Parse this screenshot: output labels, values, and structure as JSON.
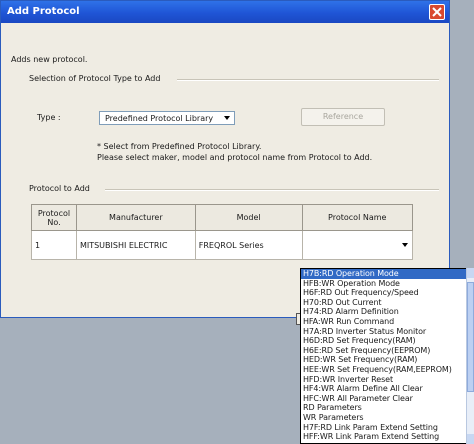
{
  "dialog": {
    "title": "Add Protocol",
    "intro": "Adds new protocol.",
    "type_section_label": "Selection of Protocol Type to Add",
    "type_label": "Type :",
    "type_value": "Predefined Protocol Library",
    "reference_button": "Reference",
    "note_line1": "* Select from Predefined Protocol Library.",
    "note_line2": "Please select maker, model and protocol name from Protocol to Add.",
    "protocol_section_label": "Protocol to Add"
  },
  "table": {
    "headers": {
      "no_line1": "Protocol",
      "no_line2": "No.",
      "manufacturer": "Manufacturer",
      "model": "Model",
      "protocol_name": "Protocol Name"
    },
    "row": {
      "no": "1",
      "manufacturer": "MITSUBISHI ELECTRIC",
      "model": "FREQROL Series",
      "protocol_name": ""
    }
  },
  "dropdown_items": [
    "H7B:RD Operation Mode",
    "HFB:WR Operation Mode",
    "H6F:RD Out Frequency/Speed",
    "H70:RD Out Current",
    "H74:RD Alarm Definition",
    "HFA:WR Run Command",
    "H7A:RD Inverter Status Monitor",
    "H6D:RD Set Frequency(RAM)",
    "H6E:RD Set Frequency(EEPROM)",
    "HED:WR Set Frequency(RAM)",
    "HEE:WR Set Frequency(RAM,EEPROM)",
    "HFD:WR Inverter Reset",
    "HF4:WR Alarm Define All Clear",
    "HFC:WR All Parameter Clear",
    "RD Parameters",
    "WR Parameters",
    "H7F:RD Link Param Extend Setting",
    "HFF:WR Link Param Extend Setting"
  ],
  "selected_index": 0,
  "colors": {
    "title_bar": "#2f72e8",
    "selection": "#316ac5",
    "close_button": "#d9492e"
  }
}
